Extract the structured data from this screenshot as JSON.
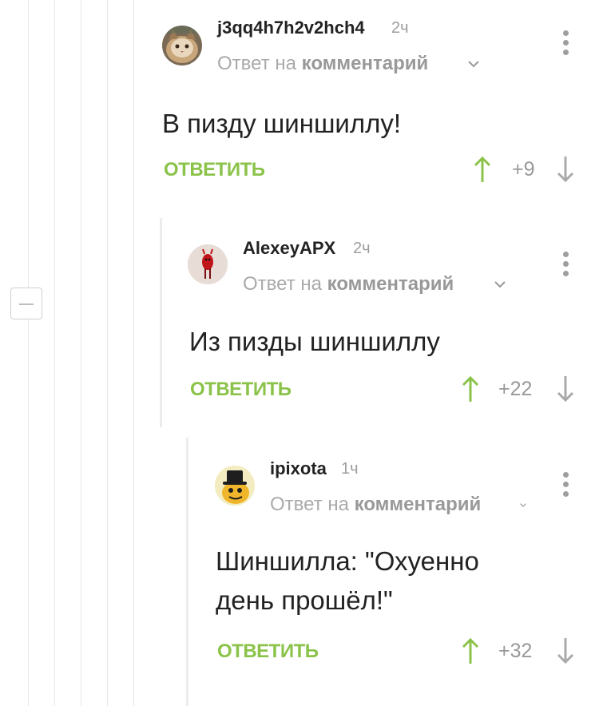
{
  "comments": [
    {
      "author": "j3qq4h7h2v2hch4",
      "time": "2ч",
      "reply_prefix": "Ответ на",
      "reply_target": "комментарий",
      "lines": [
        "В пизду шиншиллу!"
      ],
      "reply_label": "ОТВЕТИТЬ",
      "score": "+9",
      "avatar": "cat-avatar"
    },
    {
      "author": "AlexeyAPX",
      "time": "2ч",
      "reply_prefix": "Ответ на",
      "reply_target": "комментарий",
      "lines": [
        "Из пизды шиншиллу"
      ],
      "reply_label": "ОТВЕТИТЬ",
      "score": "+22",
      "avatar": "red-figure-avatar"
    },
    {
      "author": "ipixota",
      "time": "1ч",
      "reply_prefix": "Ответ на",
      "reply_target": "комментарий",
      "lines": [
        "Шиншилла: \"Охуенно",
        "день прошёл!\""
      ],
      "reply_label": "ОТВЕТИТЬ",
      "score": "+32",
      "avatar": "hat-creature-avatar"
    }
  ],
  "icons": {
    "upvote": "arrow-up-icon",
    "downvote": "arrow-down-icon",
    "menu": "kebab-menu-icon",
    "expand": "chevron-down-icon",
    "collapse": "collapse-thread-icon"
  },
  "colors": {
    "accent": "#8bc34a",
    "muted": "#9e9e9e",
    "thread_line": "#e6e6e6"
  }
}
